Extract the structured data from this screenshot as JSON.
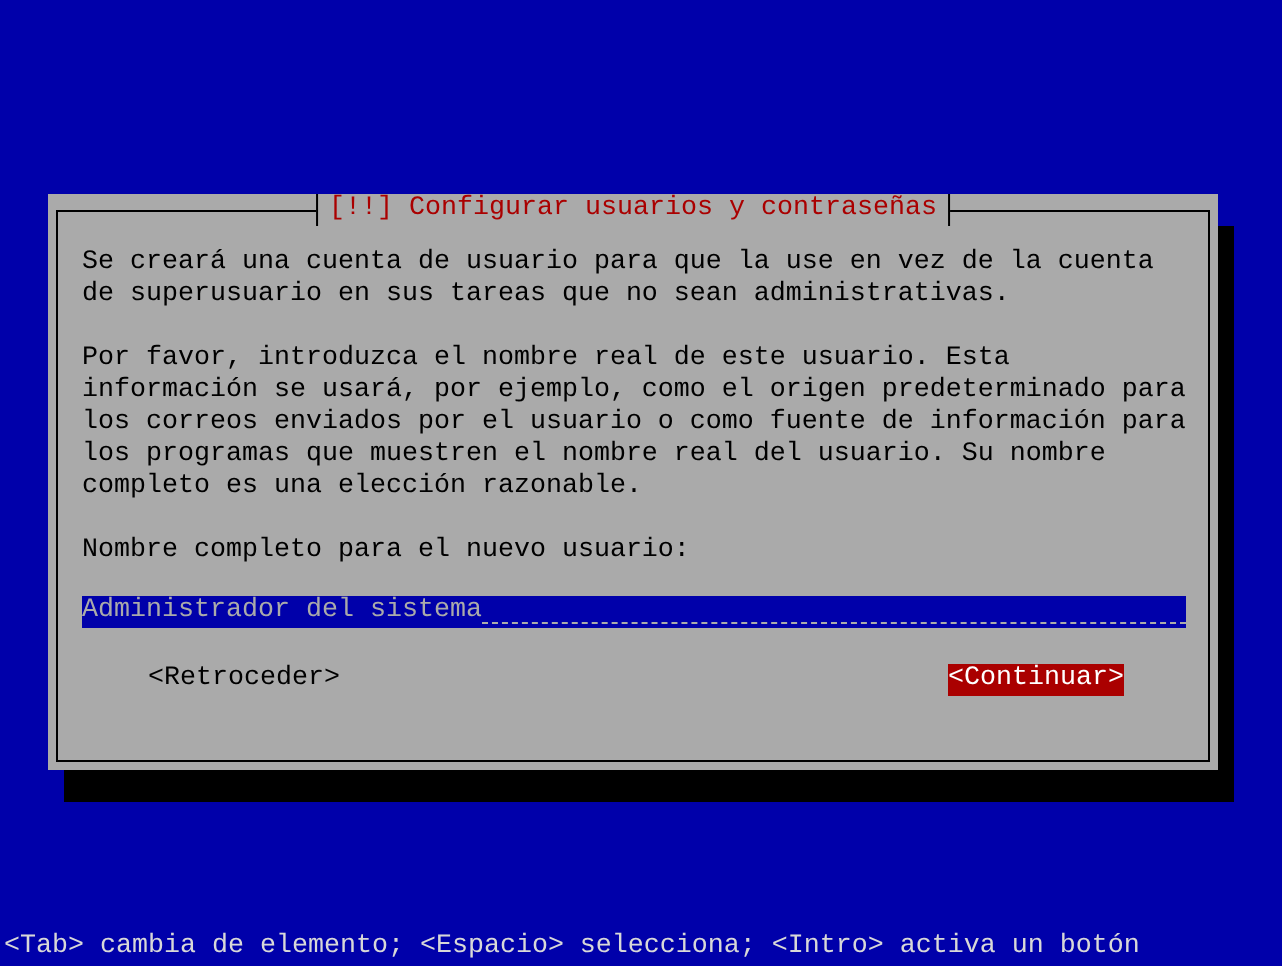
{
  "dialog": {
    "title": "[!!] Configurar usuarios y contraseñas",
    "paragraphs": [
      {
        "lines": [
          "Se creará una cuenta de usuario para que la use en vez de la cuenta",
          "de superusuario en sus tareas que no sean administrativas."
        ]
      },
      {
        "lines": [
          "Por favor, introduzca el nombre real de este usuario. Esta",
          "información se usará, por ejemplo, como el origen predeterminado para",
          "los correos enviados por el usuario o como fuente de información para",
          "los programas que muestren el nombre real del usuario. Su nombre",
          "completo es una elección razonable."
        ]
      }
    ],
    "field_label": "Nombre completo para el nuevo usuario:",
    "field": {
      "value": "Administrador del sistema",
      "focused": true
    },
    "buttons": [
      {
        "label": "<Retroceder>",
        "selected": false
      },
      {
        "label": "<Continuar>",
        "selected": true
      }
    ]
  },
  "status_bar": "<Tab> cambia de elemento; <Espacio> selecciona; <Intro> activa un botón"
}
